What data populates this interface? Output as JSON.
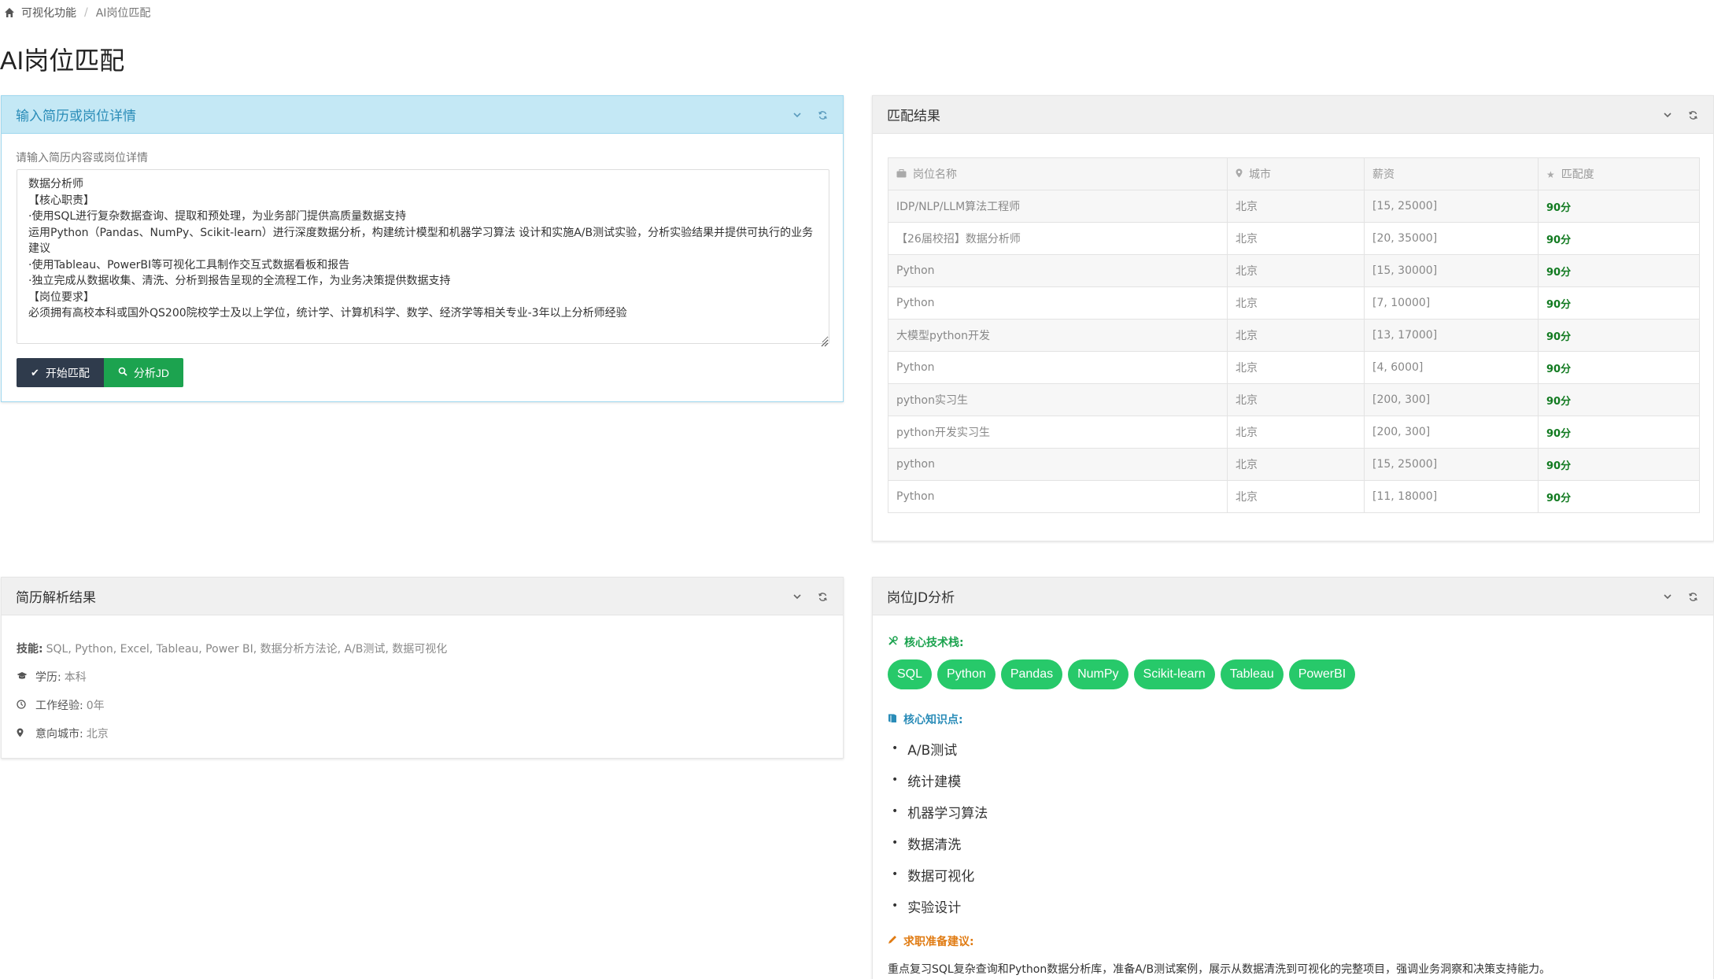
{
  "breadcrumb": {
    "home": "可视化功能",
    "separator": "/",
    "current": "AI岗位匹配"
  },
  "page_title": "AI岗位匹配",
  "input_panel": {
    "title": "输入简历或岗位详情",
    "label": "请输入简历内容或岗位详情",
    "text": "数据分析师\n【核心职责】\n·使用SQL进行复杂数据查询、提取和预处理，为业务部门提供高质量数据支持\n运用Python（Pandas、NumPy、Scikit-learn）进行深度数据分析，构建统计模型和机器学习算法 设计和实施A/B测试实验，分析实验结果并提供可执行的业务建议\n·使用Tableau、PowerBI等可视化工具制作交互式数据看板和报告\n·独立完成从数据收集、清洗、分析到报告呈现的全流程工作，为业务决策提供数据支持\n【岗位要求】\n必须拥有高校本科或国外QS200院校学士及以上学位，统计学、计算机科学、数学、经济学等相关专业-3年以上分析师经验",
    "match_button": "开始匹配",
    "analyze_button": "分析JD"
  },
  "results_panel": {
    "title": "匹配结果",
    "headers": [
      "岗位名称",
      "城市",
      "薪资",
      "匹配度"
    ],
    "rows": [
      [
        "IDP/NLP/LLM算法工程师",
        "北京",
        "[15, 25000]",
        "90分"
      ],
      [
        "【26届校招】数据分析师",
        "北京",
        "[20, 35000]",
        "90分"
      ],
      [
        "Python",
        "北京",
        "[15, 30000]",
        "90分"
      ],
      [
        "Python",
        "北京",
        "[7, 10000]",
        "90分"
      ],
      [
        "大模型python开发",
        "北京",
        "[13, 17000]",
        "90分"
      ],
      [
        "Python",
        "北京",
        "[4, 6000]",
        "90分"
      ],
      [
        "python实习生",
        "北京",
        "[200, 300]",
        "90分"
      ],
      [
        "python开发实习生",
        "北京",
        "[200, 300]",
        "90分"
      ],
      [
        "python",
        "北京",
        "[15, 25000]",
        "90分"
      ],
      [
        "Python",
        "北京",
        "[11, 18000]",
        "90分"
      ]
    ]
  },
  "parse_panel": {
    "title": "简历解析结果",
    "skills_label": "技能:",
    "skills_value": "SQL, Python, Excel, Tableau, Power BI, 数据分析方法论, A/B测试, 数据可视化",
    "education_label": "学历:",
    "education_value": "本科",
    "experience_label": "工作经验:",
    "experience_value": "0年",
    "city_label": "意向城市:",
    "city_value": "北京"
  },
  "jd_panel": {
    "title": "岗位JD分析",
    "tech_title": "核心技术栈:",
    "tags": [
      "SQL",
      "Python",
      "Pandas",
      "NumPy",
      "Scikit-learn",
      "Tableau",
      "PowerBI"
    ],
    "knowledge_title": "核心知识点:",
    "knowledge": [
      "A/B测试",
      "统计建模",
      "机器学习算法",
      "数据清洗",
      "数据可视化",
      "实验设计"
    ],
    "advice_title": "求职准备建议:",
    "advice_text": "重点复习SQL复杂查询和Python数据分析库，准备A/B测试案例，展示从数据清洗到可视化的完整项目，强调业务洞察和决策支持能力。"
  },
  "colors": {
    "accent_green": "#1ca34f",
    "tag_green": "#27c96a",
    "info_blue": "#2a8cb8",
    "dark_button": "#2f3b4c",
    "score_green": "#117a20"
  }
}
